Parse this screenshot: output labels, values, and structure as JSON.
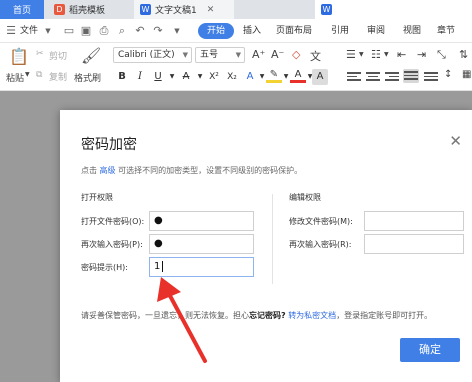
{
  "tabs": {
    "home": "首页",
    "template": "稻壳模板",
    "document": "文字文稿1"
  },
  "menu": {
    "file": "文件",
    "start": "开始",
    "insert": "插入",
    "layout": "页面布局",
    "references": "引用",
    "review": "审阅",
    "view": "视图",
    "chapter": "章节"
  },
  "toolbar": {
    "cut": "剪切",
    "copy": "复制",
    "paste": "粘贴",
    "format_painter": "格式刷",
    "font_name": "Calibri (正文)",
    "font_size": "五号"
  },
  "dialog": {
    "title": "密码加密",
    "desc_prefix": "点击",
    "desc_link": "高级",
    "desc_suffix": "可选择不同的加密类型，设置不同级别的密码保护。",
    "open_section": "打开权限",
    "edit_section": "编辑权限",
    "open_password_label": "打开文件密码(O):",
    "open_password_value": "●",
    "reenter_open_label": "再次输入密码(P):",
    "reenter_open_value": "●",
    "hint_label": "密码提示(H):",
    "hint_value": "1",
    "modify_password_label": "修改文件密码(M):",
    "reenter_modify_label": "再次输入密码(R):",
    "note_part1": "请妥善保管密码，一旦遗忘，则无法恢复。担心",
    "note_bold": "忘记密码?",
    "note_link": "转为私密文档",
    "note_part2": "，登录指定账号即可打开。",
    "ok": "确定"
  },
  "colors": {
    "accent": "#3f7fe6",
    "link": "#2f6be0",
    "arrow": "#e8312a"
  }
}
